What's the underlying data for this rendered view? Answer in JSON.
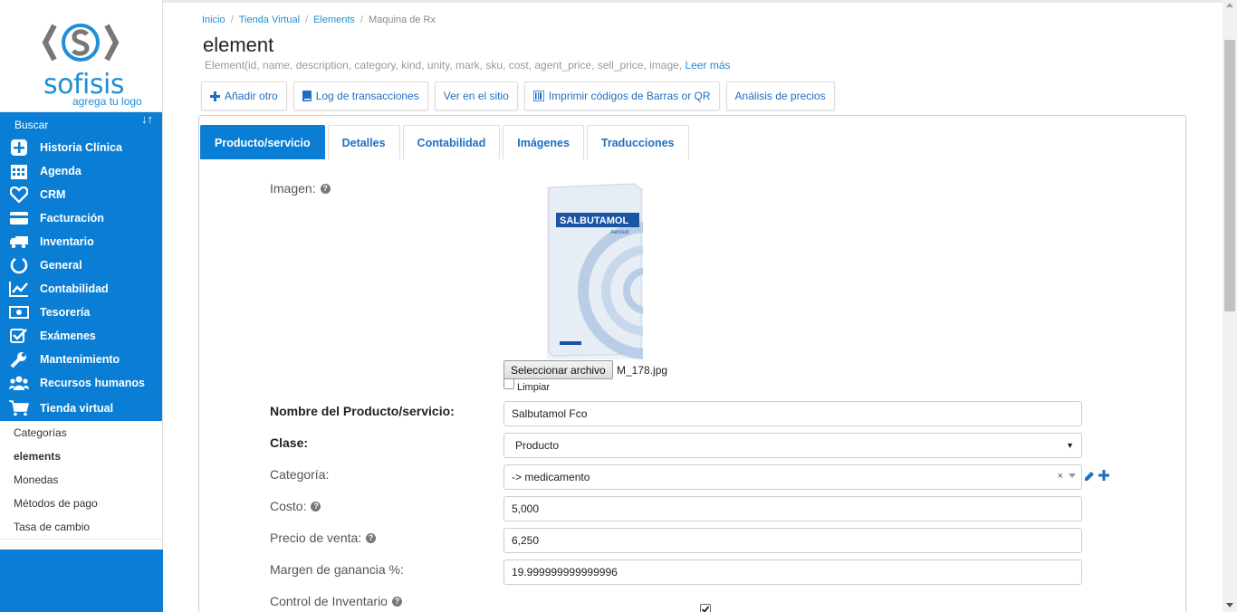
{
  "sidebar": {
    "logo_text": "sofisis",
    "logo_tagline": "agrega tu logo",
    "search_label": "Buscar",
    "sort_icon": "sort-icon",
    "menu": [
      {
        "label": "Historia Clínica",
        "icon": "plus-square-icon"
      },
      {
        "label": "Agenda",
        "icon": "calendar-icon"
      },
      {
        "label": "CRM",
        "icon": "heart-icon"
      },
      {
        "label": "Facturación",
        "icon": "credit-card-icon"
      },
      {
        "label": "Inventario",
        "icon": "truck-icon"
      },
      {
        "label": "General",
        "icon": "circle-notch-icon"
      },
      {
        "label": "Contabilidad",
        "icon": "chart-line-icon"
      },
      {
        "label": "Tesorería",
        "icon": "money-icon"
      },
      {
        "label": "Exámenes",
        "icon": "check-square-icon"
      },
      {
        "label": "Mantenimiento",
        "icon": "wrench-icon"
      },
      {
        "label": "Recursos humanos",
        "icon": "users-icon"
      },
      {
        "label": "Tienda virtual",
        "icon": "cart-icon"
      }
    ],
    "submenu": [
      {
        "label": "Categorías",
        "active": false
      },
      {
        "label": "elements",
        "active": true
      },
      {
        "label": "Monedas",
        "active": false
      },
      {
        "label": "Métodos de pago",
        "active": false
      },
      {
        "label": "Tasa de cambio",
        "active": false
      }
    ],
    "accent_color": "#0a7ed4"
  },
  "breadcrumb": [
    "Inicio",
    "Tienda Virtual",
    "Elements",
    "Maquina de Rx"
  ],
  "page": {
    "title": "element",
    "subtitle": "Element(id, name, description, category, kind, unity, mark, sku, cost, agent_price, sell_price, image,",
    "read_more": "Leer más"
  },
  "toolbar": [
    {
      "label": "Añadir otro",
      "icon": "plus-icon"
    },
    {
      "label": "Log de transacciones",
      "icon": "book-icon"
    },
    {
      "label": "Ver en el sitio",
      "icon": ""
    },
    {
      "label": "Imprimir códigos de Barras or QR",
      "icon": "barcode-icon"
    },
    {
      "label": "Análisis de precios",
      "icon": ""
    }
  ],
  "tabs": [
    {
      "label": "Producto/servicio",
      "active": true
    },
    {
      "label": "Detalles",
      "active": false
    },
    {
      "label": "Contabilidad",
      "active": false
    },
    {
      "label": "Imágenes",
      "active": false
    },
    {
      "label": "Traducciones",
      "active": false
    }
  ],
  "form": {
    "image_label": "Imagen:",
    "product_image_text": "SALBUTAMOL",
    "product_image_subtext": "Aerosol",
    "file_button": "Seleccionar archivo",
    "file_name": "M_178.jpg",
    "clear_label": "Limpiar",
    "name_label": "Nombre del Producto/servicio:",
    "name_value": "Salbutamol Fco",
    "class_label": "Clase:",
    "class_value": "Producto",
    "category_label": "Categoría:",
    "category_value": "-> medicamento",
    "cost_label": "Costo:",
    "cost_value": "5,000",
    "price_label": "Precio de venta:",
    "price_value": "6,250",
    "margin_label": "Margen de ganancia %:",
    "margin_value": "19.999999999999996",
    "inventory_label": "Control de Inventario",
    "inventory_checked": true
  }
}
